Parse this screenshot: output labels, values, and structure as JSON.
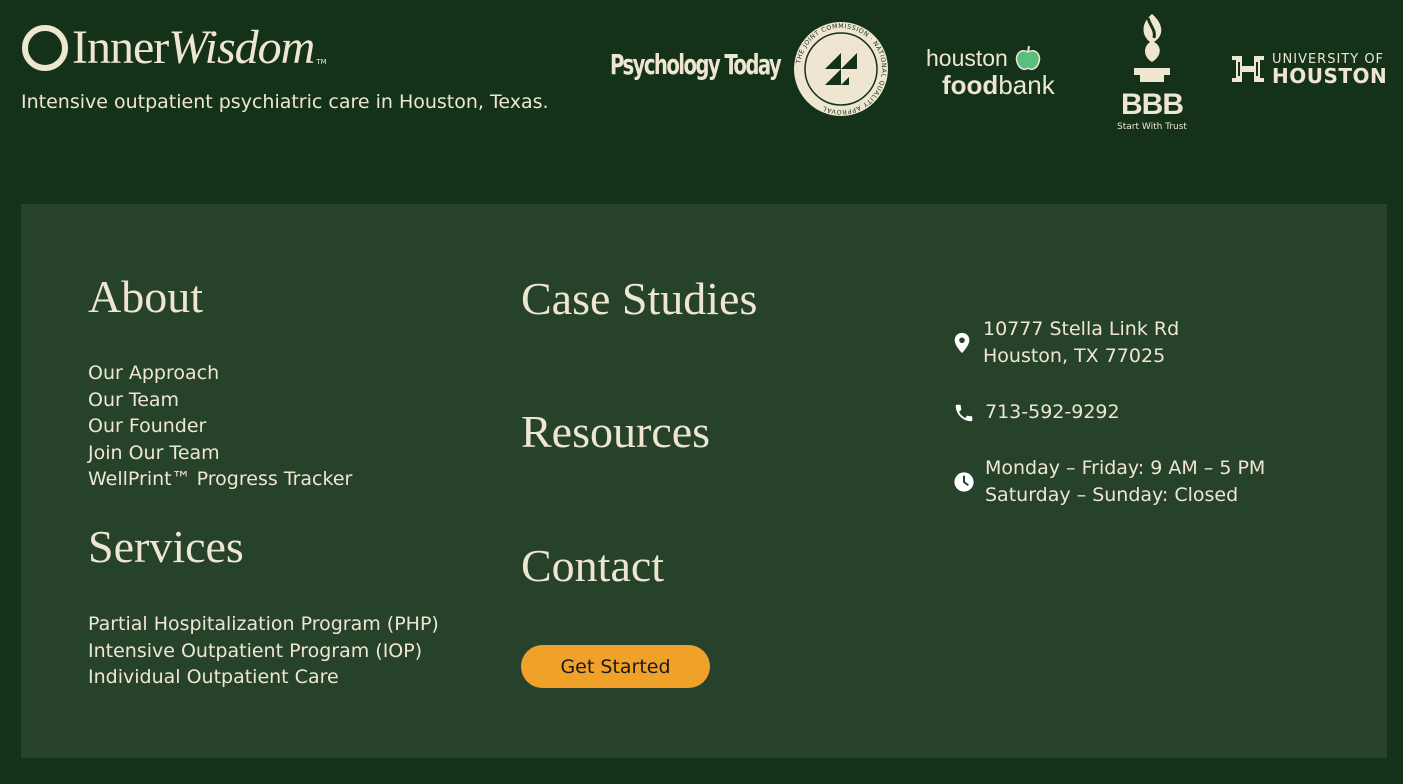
{
  "brand": {
    "name_part1": "Inner",
    "name_part2": "Wisdom",
    "trademark": "TM",
    "tagline": "Intensive outpatient psychiatric care in Houston, Texas."
  },
  "partners": {
    "psychology_today": "Psychology Today",
    "joint_commission_ring": "THE JOINT COMMISSION · NATIONAL QUALITY APPROVAL",
    "food_bank_line1": "houston",
    "food_bank_line2a": "food",
    "food_bank_line2b": "bank",
    "bbb_text": "BBB",
    "bbb_sub": "Start With Trust",
    "uh_line1": "UNIVERSITY OF",
    "uh_line2": "HOUSTON"
  },
  "footer": {
    "about": {
      "heading": "About",
      "links": [
        "Our Approach",
        "Our Team",
        "Our Founder",
        "Join Our Team",
        "WellPrint™ Progress Tracker"
      ]
    },
    "services": {
      "heading": "Services",
      "links": [
        "Partial Hospitalization Program (PHP)",
        "Intensive Outpatient Program (IOP)",
        "Individual Outpatient Care"
      ]
    },
    "case_studies": "Case Studies",
    "resources": "Resources",
    "contact": "Contact",
    "cta": "Get Started",
    "address_line1": "10777 Stella Link Rd",
    "address_line2": "Houston, TX 77025",
    "phone": "713-592-9292",
    "hours_line1": "Monday – Friday: 9 AM – 5 PM",
    "hours_line2": "Saturday – Sunday: Closed",
    "icons": [
      "map-pin-icon",
      "phone-icon",
      "clock-icon"
    ]
  },
  "colors": {
    "background": "#143219",
    "panel": "#26422a",
    "text": "#efe6d2",
    "button": "#f0a12a",
    "apple": "#5bbf7c"
  }
}
